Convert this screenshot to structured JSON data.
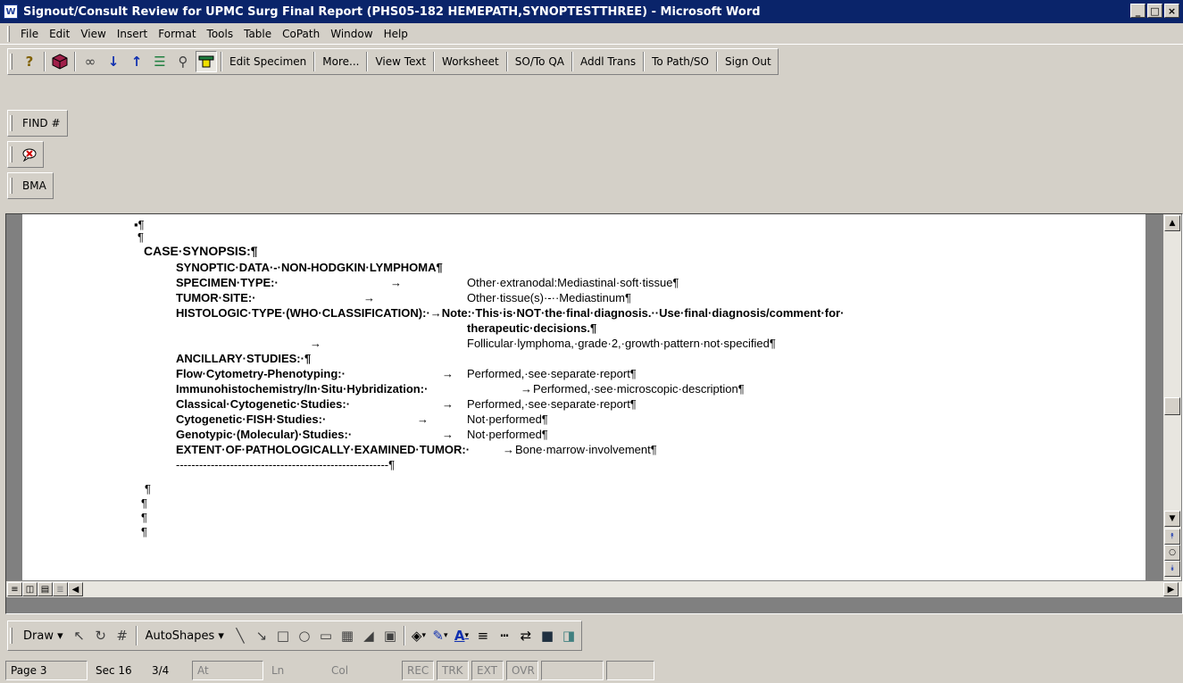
{
  "window": {
    "title": "Signout/Consult Review for UPMC Surg Final Report (PHS05-182 HEMEPATH,SYNOPTESTTHREE) - Microsoft Word",
    "app_icon": "word-icon",
    "minimize": "_",
    "maximize": "□",
    "close": "×"
  },
  "menu": [
    "File",
    "Edit",
    "View",
    "Insert",
    "Format",
    "Tools",
    "Table",
    "CoPath",
    "Window",
    "Help"
  ],
  "toolbar": {
    "icons": [
      "question-icon",
      "cube-icon",
      "glasses-icon",
      "arrow-down-icon",
      "arrow-up-icon",
      "list-icon",
      "run-icon",
      "highlight-icon"
    ],
    "buttons": [
      "Edit Specimen",
      "More...",
      "View Text",
      "Worksheet",
      "SO/To QA",
      "Addl Trans",
      "To Path/SO",
      "Sign Out"
    ]
  },
  "find_toolbar": {
    "label": "FIND #"
  },
  "comment_toolbar": {
    "icon": "speech-bubble-icon"
  },
  "bma_toolbar": {
    "label": "BMA"
  },
  "document": {
    "lines": [
      {
        "text": "▪¶",
        "bold": false
      },
      {
        "text": "¶",
        "bold": false
      },
      {
        "text": "CASE·SYNOPSIS:¶",
        "bold": true
      },
      {
        "text": "SYNOPTIC·DATA·-·NON-HODGKIN·LYMPHOMA¶",
        "bold": true
      },
      {
        "label": "SPECIMEN·TYPE:·",
        "tab": "→",
        "value": "Other·extranodal:Mediastinal·soft·tissue¶"
      },
      {
        "label": "TUMOR·SITE:·",
        "tab": "→",
        "value": "Other·tissue(s)·-··Mediastinum¶"
      },
      {
        "text": "HISTOLOGIC·TYPE·(WHO·CLASSIFICATION):·→Note:·This·is·NOT·the·final·diagnosis.··Use·final·diagnosis/comment·for·",
        "bold": true
      },
      {
        "text": "therapeutic·decisions.¶",
        "bold": true
      },
      {
        "tab": "→",
        "value": "Follicular·lymphoma,·grade·2,·growth·pattern·not·specified¶"
      },
      {
        "text": "ANCILLARY·STUDIES:·¶",
        "bold": true
      },
      {
        "label": "Flow·Cytometry-Phenotyping:·",
        "tab": "→",
        "value": "Performed,·see·separate·report¶"
      },
      {
        "label": "Immunohistochemistry/In·Situ·Hybridization:·",
        "tab": "→",
        "value": "Performed,·see·microscopic·description¶"
      },
      {
        "label": "Classical·Cytogenetic·Studies:·",
        "tab": "→",
        "value": "Performed,·see·separate·report¶"
      },
      {
        "label": "Cytogenetic·FISH·Studies:·",
        "tab": "→",
        "value": "Not·performed¶"
      },
      {
        "label": "Genotypic·(Molecular)·Studies:·",
        "tab": "→",
        "value": "Not·performed¶"
      },
      {
        "label": "EXTENT·OF·PATHOLOGICALLY·EXAMINED·TUMOR:·",
        "tab": "→",
        "value": "Bone·marrow·involvement¶"
      },
      {
        "text": "-------------------------------------------------------¶",
        "bold": false
      },
      {
        "text": "¶",
        "bold": false
      },
      {
        "text": "¶",
        "bold": false
      },
      {
        "text": "¶",
        "bold": false
      },
      {
        "text": "¶",
        "bold": false
      }
    ]
  },
  "drawing_toolbar": {
    "draw": "Draw ▾",
    "autoshapes": "AutoShapes ▾",
    "icons": [
      "cursor-icon",
      "rotate-icon",
      "grid-icon",
      "line-icon",
      "arrow-icon",
      "rectangle-icon",
      "oval-icon",
      "textbox-icon",
      "wordart-icon",
      "diagram-icon",
      "clipart-icon",
      "fill-color-icon",
      "line-color-icon",
      "font-color-icon",
      "line-style-icon",
      "dash-style-icon",
      "arrow-style-icon",
      "shadow-icon",
      "3d-icon"
    ]
  },
  "status": {
    "page": "Page 3",
    "section": "Sec 16",
    "pages": "3/4",
    "at": "At",
    "ln": "Ln",
    "col": "Col",
    "rec": "REC",
    "trk": "TRK",
    "ext": "EXT",
    "ovr": "OVR"
  },
  "colors": {
    "title_bg": "#0a246a",
    "face": "#d4d0c8"
  }
}
